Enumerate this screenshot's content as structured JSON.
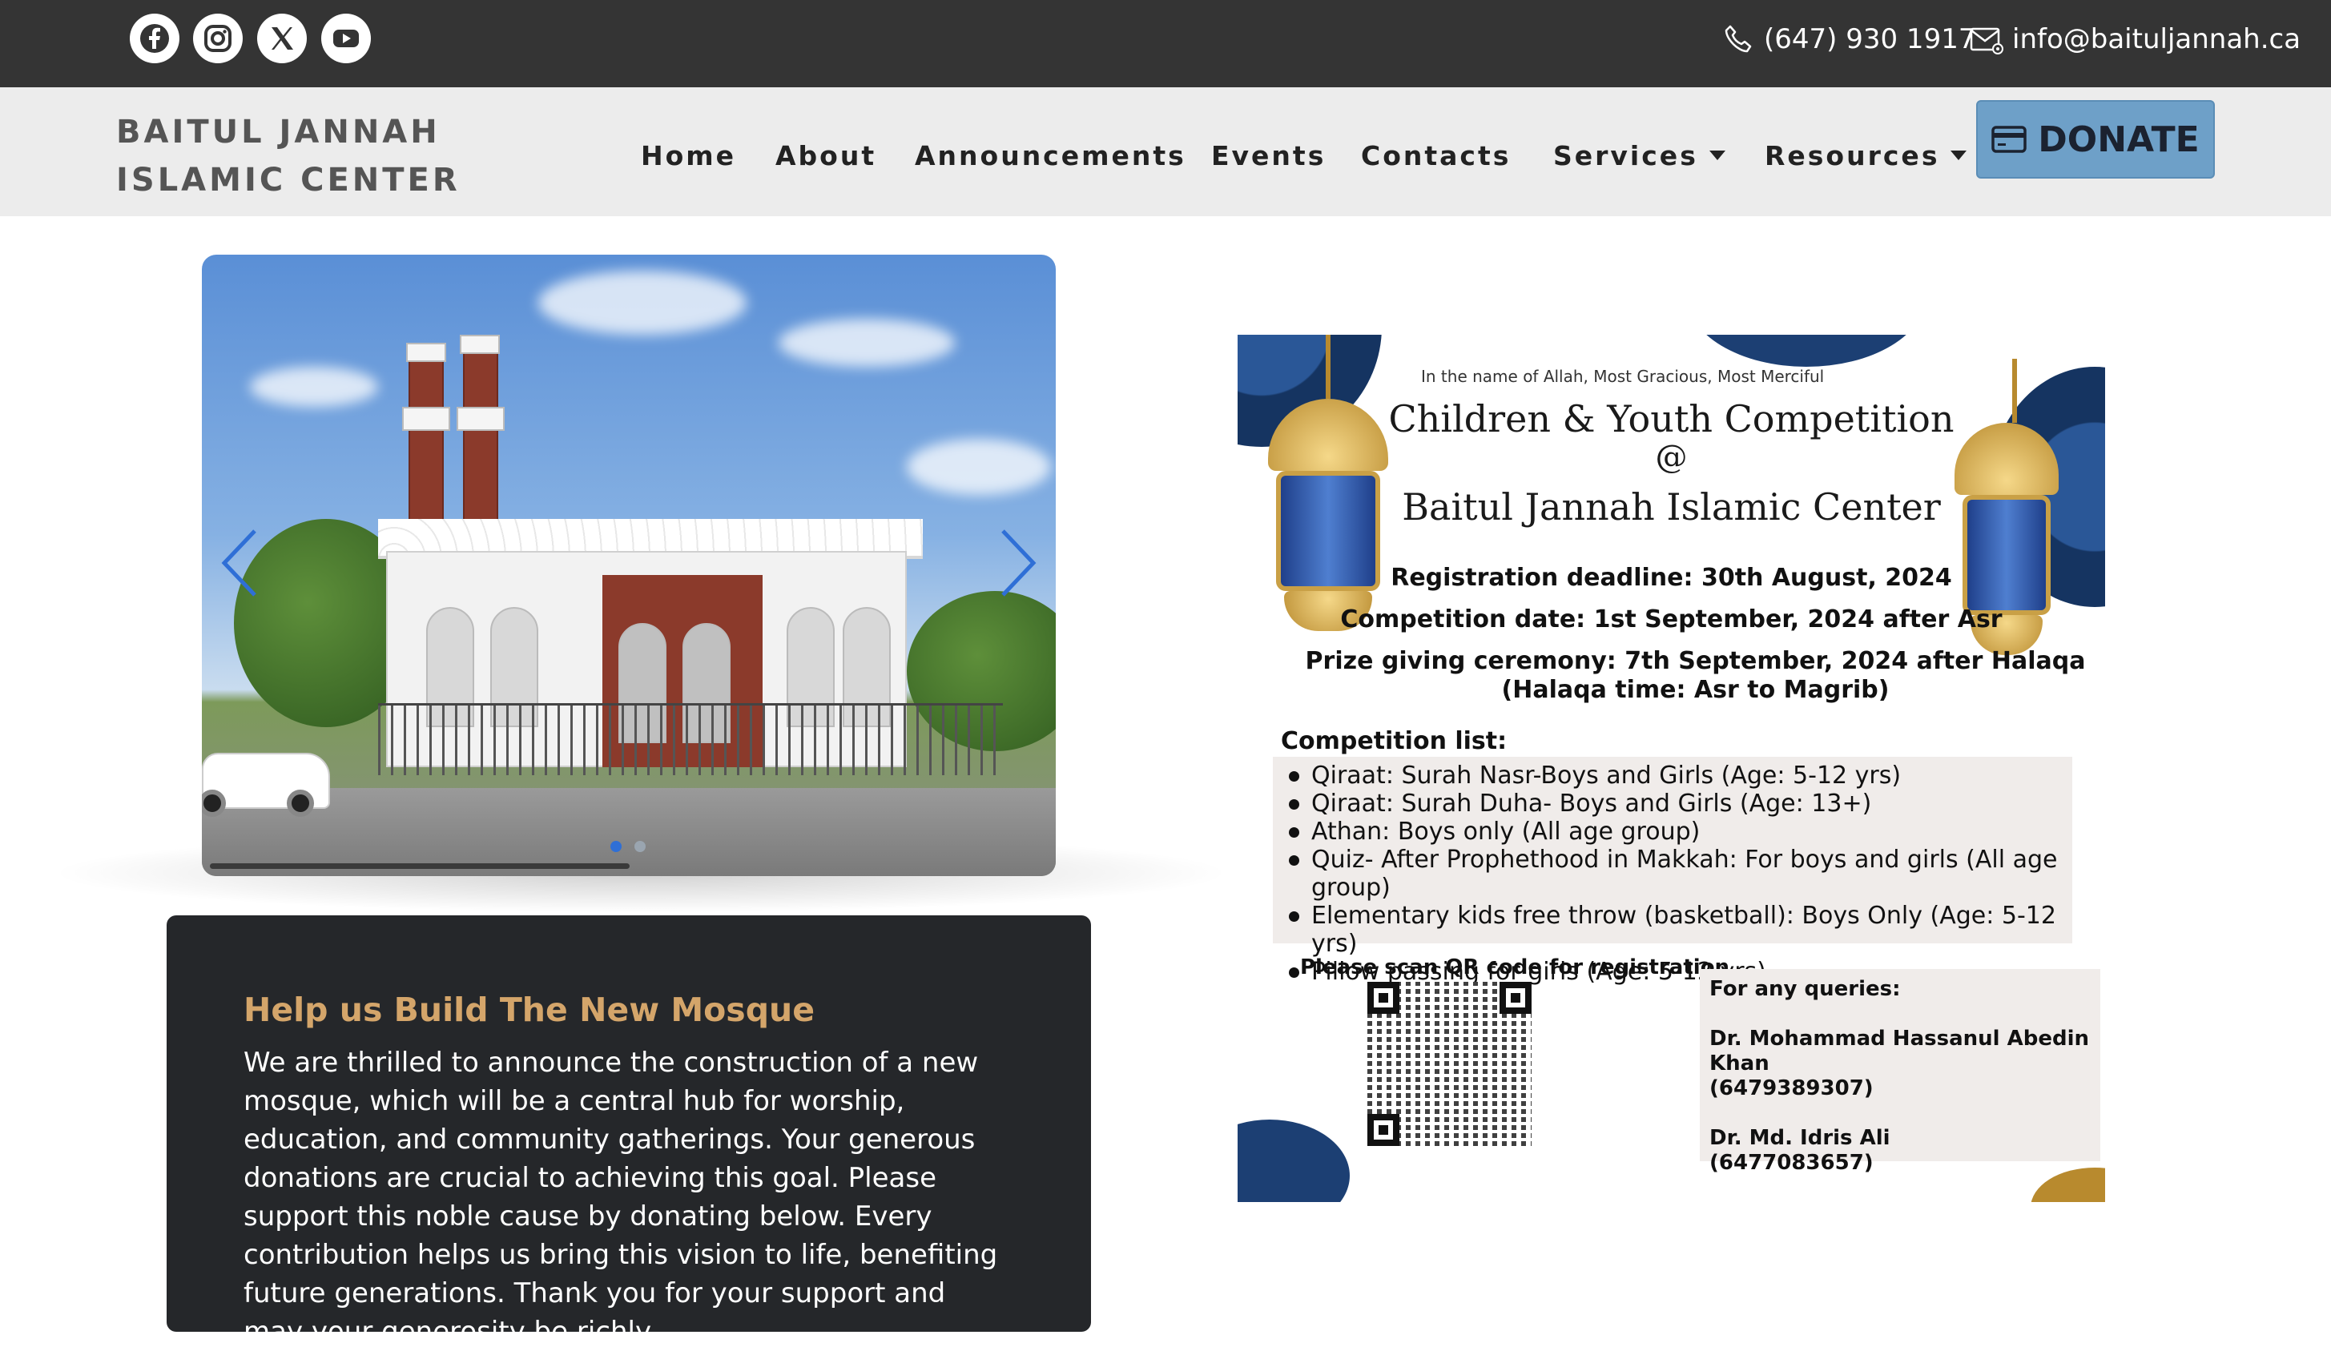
{
  "topbar": {
    "social": [
      {
        "name": "facebook-icon"
      },
      {
        "name": "instagram-icon"
      },
      {
        "name": "x-twitter-icon"
      },
      {
        "name": "youtube-icon"
      }
    ],
    "phone": "(647) 930 1917",
    "email": "info@baituljannah.ca"
  },
  "nav": {
    "brand_line1": "BAITUL JANNAH",
    "brand_line2": "ISLAMIC CENTER",
    "items": [
      "Home",
      "About",
      "Announcements",
      "Events",
      "Contacts",
      "Services",
      "Resources"
    ],
    "donate": "DONATE"
  },
  "carousel": {
    "slide_alt": "Mosque rendering",
    "active_slide": 1,
    "slide_count": 2
  },
  "card": {
    "heading": "Help us Build The New Mosque",
    "body": "We are thrilled to announce the construction of a new mosque, which will be a central hub for worship, education, and community gatherings. Your generous donations are crucial to achieving this goal. Please support this noble cause by donating below. Every contribution helps us bring this vision to life, benefiting future generations. Thank you for your support and may your generosity be richly"
  },
  "flyer": {
    "bismillah": "In the name of Allah, Most Gracious, Most Merciful",
    "title1": "Children & Youth Competition",
    "title2": "@",
    "title3": "Baitul Jannah Islamic Center",
    "deadline": "Registration deadline: 30th August, 2024",
    "competition_date": "Competition date: 1st September, 2024 after Asr",
    "prize": "Prize giving ceremony: 7th September, 2024 after Halaqa",
    "halaqa": "(Halaqa time: Asr to Magrib)",
    "list_heading": "Competition list:",
    "list": [
      "Qiraat: Surah Nasr-Boys and Girls (Age: 5-12 yrs)",
      "Qiraat: Surah Duha- Boys and Girls (Age: 13+)",
      "Athan: Boys only (All age group)",
      "Quiz- After Prophethood in Makkah: For boys and girls (All age group)",
      "Elementary kids free throw (basketball): Boys Only (Age: 5-12 yrs)",
      "Pillow passing for girls (Age: 5-12 yrs)"
    ],
    "qr_label": "Please scan QR code for registration",
    "queries_heading": "For any queries:",
    "contact1_name": "Dr. Mohammad Hassanul Abedin Khan",
    "contact1_phone": "(6479389307)",
    "contact2_name": "Dr. Md. Idris Ali",
    "contact2_phone": "(6477083657)"
  },
  "colors": {
    "topbar": "#343434",
    "navbar": "#ececec",
    "donate": "#6ea0c8",
    "card": "#25272a",
    "card_heading": "#d4a56a",
    "carousel_accent": "#2f6fd6"
  }
}
